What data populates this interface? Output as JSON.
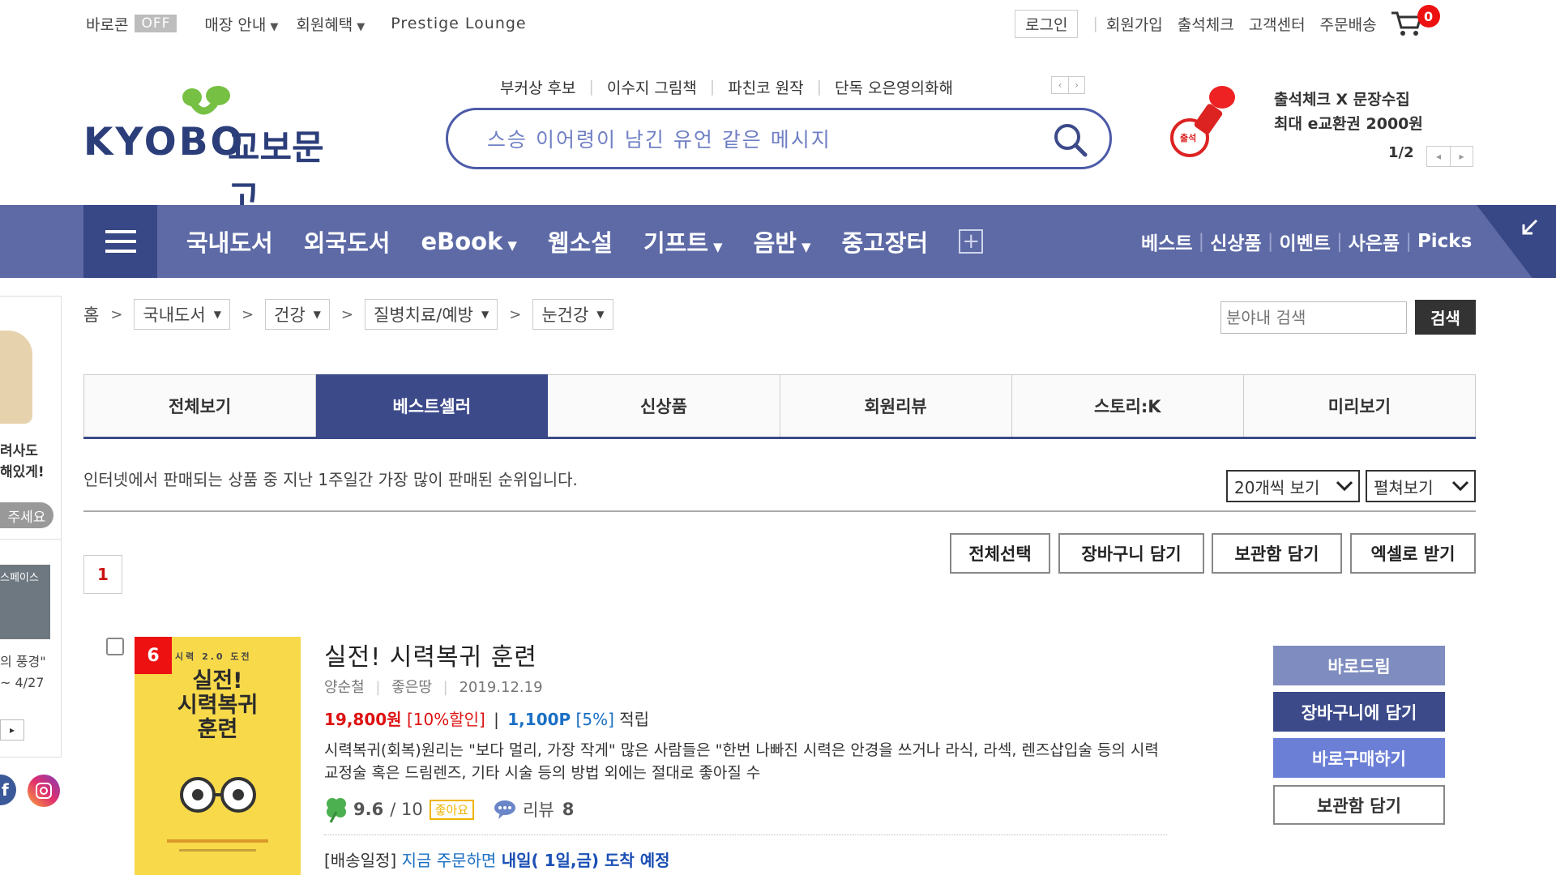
{
  "top_bar": {
    "barocoupon": "바로콘",
    "off": "OFF",
    "store_info": "매장 안내",
    "member_benefit": "회원혜택",
    "prestige": "Prestige Lounge",
    "login": "로그인",
    "signup": "회원가입",
    "attendance": "출석체크",
    "customer_center": "고객센터",
    "order_delivery": "주문배송",
    "cart_count": "0"
  },
  "logo": {
    "en": "KYOBO",
    "ko": "교보문고"
  },
  "hot_keywords": [
    "부커상 후보",
    "이수지 그림책",
    "파친코 원작",
    "단독 오은영의화해"
  ],
  "search": {
    "placeholder": "스승 이어령이 남긴 유언 같은 메시지"
  },
  "promo": {
    "line1": "출석체크 X 문장수집",
    "line2": "최대 e교환권 2000원",
    "pager": "1/2",
    "stamp_text": "출석"
  },
  "nav": {
    "items": [
      "국내도서",
      "외국도서",
      "eBook",
      "웹소설",
      "기프트",
      "음반",
      "중고장터"
    ],
    "right": [
      "베스트",
      "신상품",
      "이벤트",
      "사은품",
      "Picks"
    ]
  },
  "left_panel": {
    "text1": "려사도",
    "text2": "해있게!",
    "btn": "주세요",
    "text3": "스페이스",
    "text4": "의 풍경\"",
    "text5": "~ 4/27"
  },
  "breadcrumb": {
    "home": "홈",
    "levels": [
      "국내도서",
      "건강",
      "질병치료/예방",
      "눈건강"
    ]
  },
  "category_search": {
    "placeholder": "분야내 검색",
    "button": "검색"
  },
  "tabs": [
    "전체보기",
    "베스트셀러",
    "신상품",
    "회원리뷰",
    "스토리:K",
    "미리보기"
  ],
  "description": "인터넷에서 판매되는 상품 중 지난 1주일간 가장 많이 판매된 순위입니다.",
  "view_options": {
    "count": "20개씩 보기",
    "mode": "펼쳐보기"
  },
  "pagination": {
    "current": "1"
  },
  "actions": [
    "전체선택",
    "장바구니 담기",
    "보관함 담기",
    "엑셀로 받기"
  ],
  "product": {
    "rank": "6",
    "title": "실전! 시력복귀 훈련",
    "author": "양순철",
    "publisher": "좋은땅",
    "date": "2019.12.19",
    "price": "19,800원",
    "discount": "[10%할인]",
    "points": "1,100P",
    "points_rate": "[5%]",
    "points_suffix": "적립",
    "description": "시력복귀(회복)원리는 \"보다 멀리, 가장 작게\" 많은 사람들은 \"한번 나빠진 시력은 안경을 쓰거나 라식, 라섹, 렌즈삽입술 등의 시력교정술 혹은 드림렌즈, 기타 시술 등의 방법 외에는 절대로 좋아질 수",
    "rating": "9.6",
    "rating_max": "/ 10",
    "rating_badge": "좋아요",
    "review_label": "리뷰",
    "review_count": "8",
    "delivery_prefix": "[배송일정]",
    "delivery_mid": "지금 주문하면",
    "delivery_bold": "내일( 1일,금) 도착 예정",
    "cover": {
      "top_line": "시력 2.0 도전",
      "title_lines": [
        "실전!",
        "시력복귀",
        "훈련"
      ]
    }
  },
  "side_buttons": [
    "바로드림",
    "장바구니에 담기",
    "바로구매하기",
    "보관함 담기"
  ]
}
